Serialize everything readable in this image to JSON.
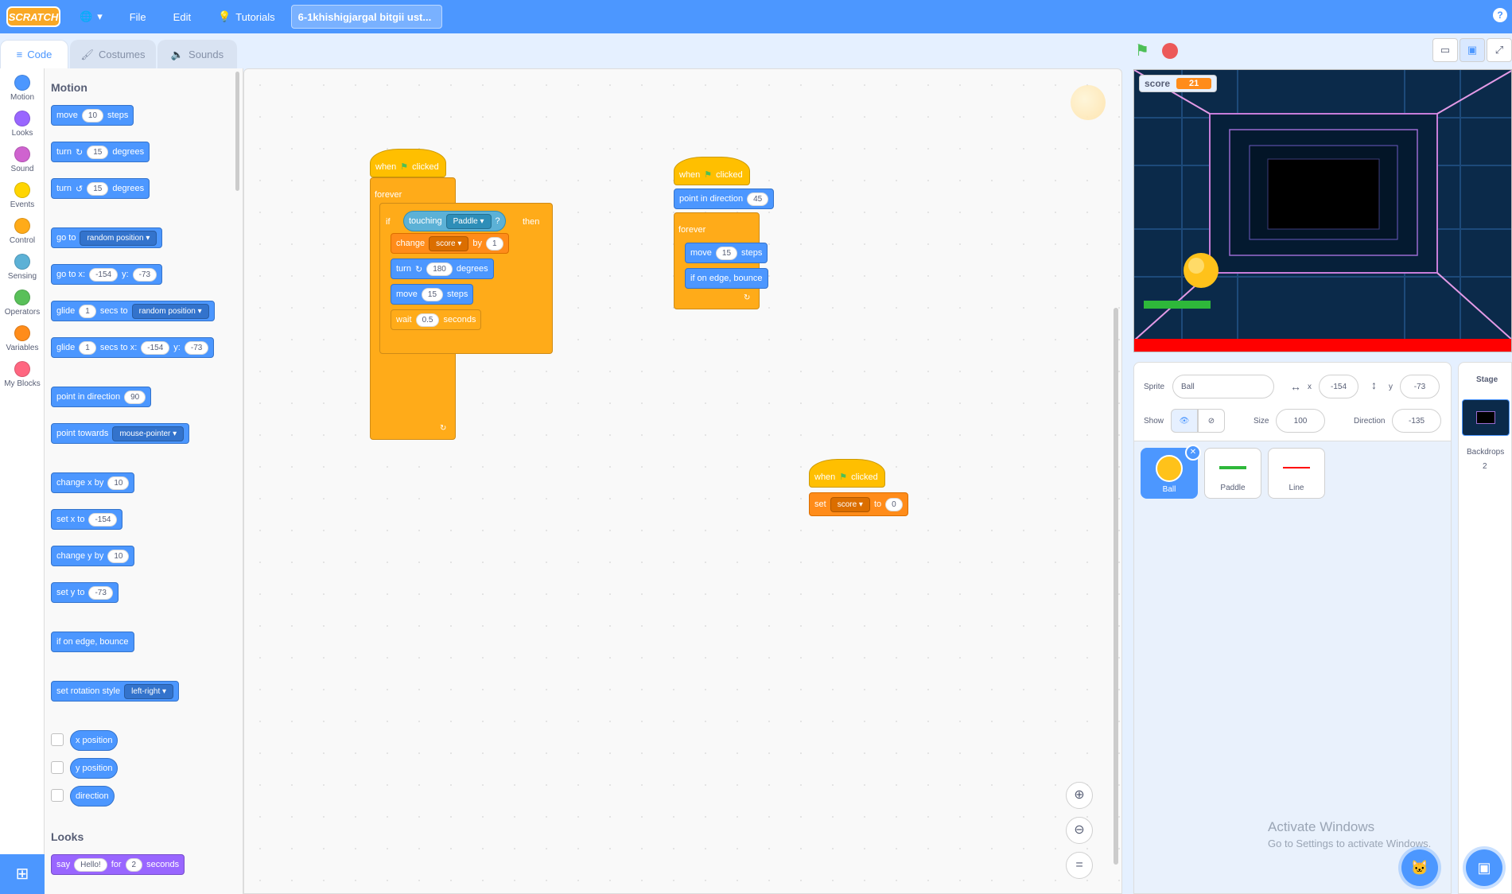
{
  "topbar": {
    "logo": "SCRATCH",
    "file": "File",
    "edit": "Edit",
    "tutorials": "Tutorials",
    "project_title": "6-1khishigjargal bitgii ust...",
    "help": "?"
  },
  "tabs": {
    "code": "Code",
    "costumes": "Costumes",
    "sounds": "Sounds"
  },
  "categories": [
    {
      "label": "Motion",
      "color": "#4c97ff"
    },
    {
      "label": "Looks",
      "color": "#9966ff"
    },
    {
      "label": "Sound",
      "color": "#cf63cf"
    },
    {
      "label": "Events",
      "color": "#ffd500"
    },
    {
      "label": "Control",
      "color": "#ffab19"
    },
    {
      "label": "Sensing",
      "color": "#5cb1d6"
    },
    {
      "label": "Operators",
      "color": "#59c059"
    },
    {
      "label": "Variables",
      "color": "#ff8c1a"
    },
    {
      "label": "My Blocks",
      "color": "#ff6680"
    }
  ],
  "palette": {
    "motion_head": "Motion",
    "looks_head": "Looks",
    "move": "move",
    "move_n": "10",
    "steps": "steps",
    "turn": "turn",
    "turn_n": "15",
    "degrees": "degrees",
    "goto": "go to",
    "random_position": "random position",
    "goto_xy": "go to x:",
    "x_val": "-154",
    "y_lbl": "y:",
    "y_val": "-73",
    "glide": "glide",
    "glide_n": "1",
    "secs_to": "secs to",
    "secs_to_x": "secs to x:",
    "point_dir": "point in direction",
    "dir_val": "90",
    "point_towards": "point towards",
    "mouse_pointer": "mouse-pointer",
    "change_x": "change x by",
    "change_x_n": "10",
    "set_x": "set x to",
    "set_x_n": "-154",
    "change_y": "change y by",
    "change_y_n": "10",
    "set_y": "set y to",
    "set_y_n": "-73",
    "edge_bounce": "if on edge, bounce",
    "rot_style": "set rotation style",
    "left_right": "left-right",
    "x_position": "x position",
    "y_position": "y position",
    "direction": "direction",
    "say": "say",
    "hello": "Hello!",
    "for": "for",
    "say_n": "2",
    "seconds": "seconds"
  },
  "scripts": {
    "s1": {
      "when": "when",
      "clicked": "clicked",
      "forever": "forever",
      "if": "if",
      "touching": "touching",
      "paddle": "Paddle",
      "q": "?",
      "then": "then",
      "change": "change",
      "score": "score",
      "by": "by",
      "by_n": "1",
      "turn": "turn",
      "turn_n": "180",
      "degrees": "degrees",
      "move": "move",
      "move_n": "15",
      "steps": "steps",
      "wait": "wait",
      "wait_n": "0.5",
      "seconds": "seconds"
    },
    "s2": {
      "when": "when",
      "clicked": "clicked",
      "point_dir": "point in direction",
      "dir_n": "45",
      "forever": "forever",
      "move": "move",
      "move_n": "15",
      "steps": "steps",
      "bounce": "if on edge, bounce"
    },
    "s3": {
      "when": "when",
      "clicked": "clicked",
      "set": "set",
      "score": "score",
      "to": "to",
      "to_n": "0"
    }
  },
  "stage": {
    "score_label": "score",
    "score_value": "21"
  },
  "sprite_info": {
    "sprite_label": "Sprite",
    "sprite_name": "Ball",
    "x_label": "x",
    "x": "-154",
    "y_label": "y",
    "y": "-73",
    "show_label": "Show",
    "size_label": "Size",
    "size": "100",
    "direction_label": "Direction",
    "direction": "-135"
  },
  "sprites": [
    {
      "name": "Ball"
    },
    {
      "name": "Paddle"
    },
    {
      "name": "Line"
    }
  ],
  "stage_pane": {
    "title": "Stage",
    "backdrops_label": "Backdrops",
    "backdrops_count": "2"
  },
  "watermark": {
    "line1": "Activate Windows",
    "line2": "Go to Settings to activate Windows."
  }
}
